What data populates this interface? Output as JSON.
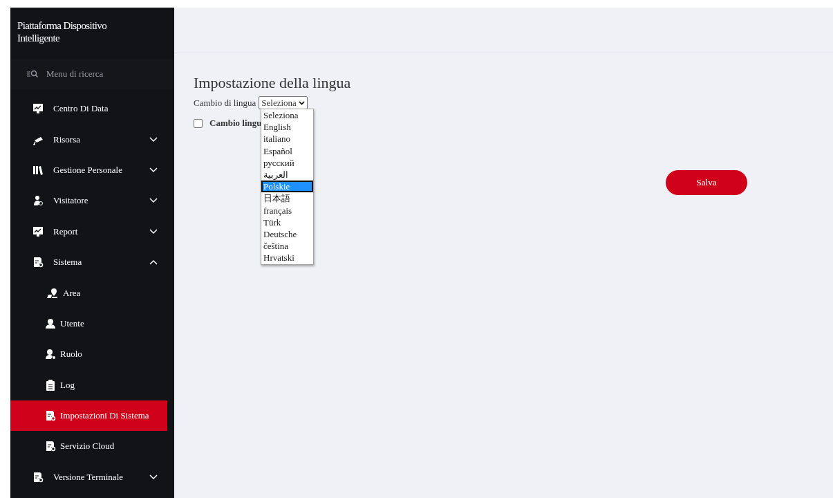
{
  "sidebar": {
    "title": "Piattaforma Dispositivo Intelligente",
    "search": {
      "placeholder": "Menu di ricerca"
    },
    "items": [
      {
        "label": "Centro Di Data",
        "selected": false
      },
      {
        "label": "Risorsa",
        "expanded": false,
        "selected": false
      },
      {
        "label": "Gestione Personale",
        "expanded": false,
        "selected": false
      },
      {
        "label": "Visitatore",
        "expanded": false,
        "selected": false
      },
      {
        "label": "Report",
        "expanded": false,
        "selected": false
      },
      {
        "label": "Sistema",
        "expanded": true,
        "selected": false,
        "children": [
          {
            "label": "Area",
            "selected": false
          },
          {
            "label": "Utente",
            "selected": false
          },
          {
            "label": "Ruolo",
            "selected": false
          },
          {
            "label": "Log",
            "selected": false
          },
          {
            "label": "Impostazioni Di Sistema",
            "selected": true
          },
          {
            "label": "Servizio Cloud",
            "selected": false
          }
        ]
      },
      {
        "label": "Versione Terminale",
        "expanded": false,
        "selected": false
      }
    ]
  },
  "main": {
    "heading": "Impostazione della lingua",
    "language_label": "Cambio di lingua",
    "select_value": "Seleziona",
    "options": [
      {
        "label": "Seleziona",
        "selected": false
      },
      {
        "label": "English",
        "selected": false
      },
      {
        "label": "italiano",
        "selected": false
      },
      {
        "label": "Español",
        "selected": false
      },
      {
        "label": "русский",
        "selected": false
      },
      {
        "label": "العربية",
        "selected": false
      },
      {
        "label": "Polskie",
        "selected": true
      },
      {
        "label": "日本語",
        "selected": false
      },
      {
        "label": "français",
        "selected": false
      },
      {
        "label": "Türk",
        "selected": false
      },
      {
        "label": "Deutsche",
        "selected": false
      },
      {
        "label": "čeština",
        "selected": false
      },
      {
        "label": "Hrvatski",
        "selected": false
      }
    ],
    "checkbox": {
      "label": "Cambio lingu",
      "checked": false
    },
    "save_button": "Salva"
  }
}
